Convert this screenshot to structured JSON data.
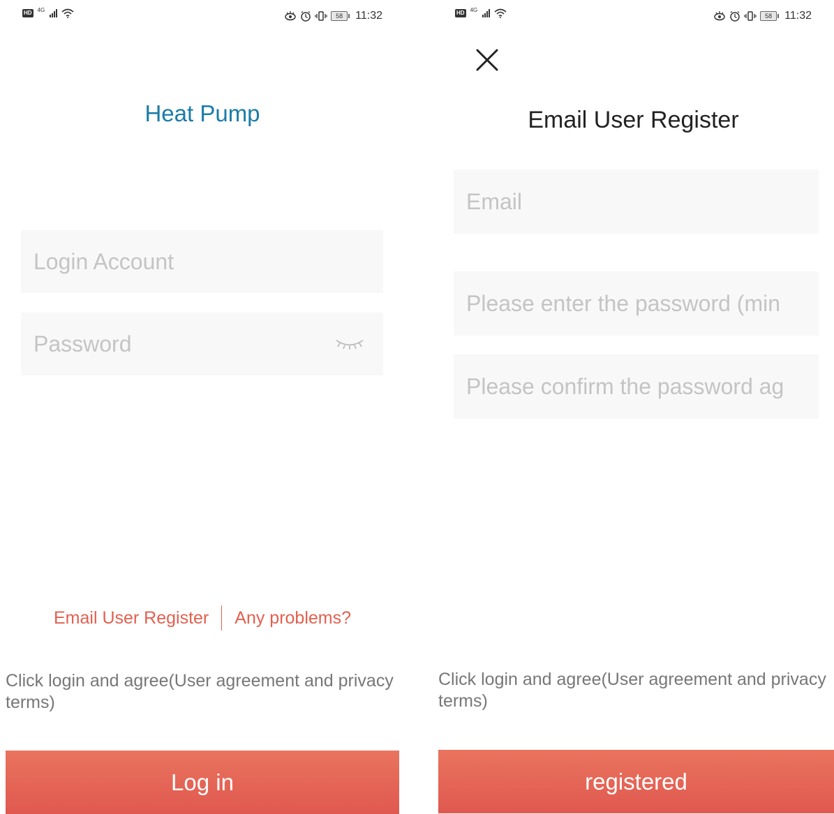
{
  "login_screen": {
    "status_bar": {
      "network_type": "4G",
      "time": "11:32",
      "battery": "58"
    },
    "app_title": "Heat Pump",
    "account_placeholder": "Login Account",
    "password_placeholder": "Password",
    "register_link": "Email User Register",
    "problems_link": "Any problems?",
    "agreement_text": "Click login and agree(User agreement and privacy terms)",
    "login_button": "Log in"
  },
  "register_screen": {
    "status_bar": {
      "network_type": "4G",
      "time": "11:32",
      "battery": "58"
    },
    "title": "Email User Register",
    "email_placeholder": "Email",
    "password_placeholder": "Please enter the password (min",
    "confirm_placeholder": "Please confirm the password ag",
    "agreement_text": "Click login and agree(User agreement and privacy terms)",
    "register_button": "registered"
  },
  "colors": {
    "title_blue": "#1b7ca8",
    "link_red": "#e2604f",
    "button_red": "#e0584f",
    "field_bg": "#f8f8f8",
    "placeholder_gray": "#c4c4c4"
  }
}
